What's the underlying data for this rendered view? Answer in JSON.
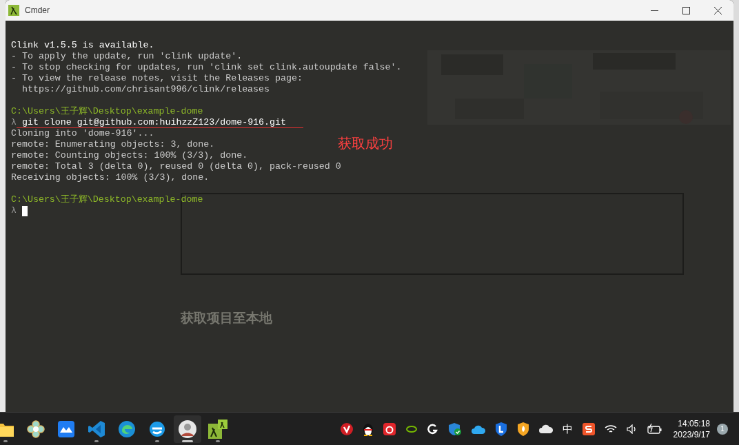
{
  "window": {
    "title": "Cmder"
  },
  "terminal": {
    "lines": [
      {
        "kind": "blank"
      },
      {
        "kind": "notice",
        "text": "Clink v1.5.5 is available."
      },
      {
        "kind": "plain",
        "text": "- To apply the update, run 'clink update'."
      },
      {
        "kind": "plain",
        "text": "- To stop checking for updates, run 'clink set clink.autoupdate false'."
      },
      {
        "kind": "plain",
        "text": "- To view the release notes, visit the Releases page:"
      },
      {
        "kind": "plain",
        "text": "  https://github.com/chrisant996/clink/releases"
      },
      {
        "kind": "blank"
      },
      {
        "kind": "path",
        "text": "C:\\Users\\王子辉\\Desktop\\example-dome"
      },
      {
        "kind": "command",
        "prompt": "λ",
        "text": "git clone git@github.com:huihzzZ123/dome-916.git",
        "underlined": true
      },
      {
        "kind": "plain",
        "text": "Cloning into 'dome-916'..."
      },
      {
        "kind": "plain",
        "text": "remote: Enumerating objects: 3, done."
      },
      {
        "kind": "plain",
        "text": "remote: Counting objects: 100% (3/3), done."
      },
      {
        "kind": "plain",
        "text": "remote: Total 3 (delta 0), reused 0 (delta 0), pack-reused 0"
      },
      {
        "kind": "plain",
        "text": "Receiving objects: 100% (3/3), done."
      },
      {
        "kind": "blank"
      },
      {
        "kind": "path",
        "text": "C:\\Users\\王子辉\\Desktop\\example-dome"
      },
      {
        "kind": "command",
        "prompt": "λ",
        "cursor": true
      }
    ]
  },
  "annotation": {
    "text": "获取成功"
  },
  "background_page": {
    "heading": "获取项目至本地"
  },
  "taskbar": {
    "apps": [
      {
        "kind": "folder",
        "running": true,
        "selected": false
      },
      {
        "kind": "flower",
        "running": false,
        "selected": false
      },
      {
        "kind": "mountain",
        "running": false,
        "selected": false
      },
      {
        "kind": "vscode",
        "running": true,
        "selected": false
      },
      {
        "kind": "edge",
        "running": false,
        "selected": false
      },
      {
        "kind": "edge2",
        "running": true,
        "selected": false
      },
      {
        "kind": "avatar",
        "running": true,
        "selected": true
      },
      {
        "kind": "cmder",
        "running": true,
        "selected": false
      }
    ],
    "tray": [
      {
        "kind": "red-v"
      },
      {
        "kind": "penguin"
      },
      {
        "kind": "music"
      },
      {
        "kind": "nvidia"
      },
      {
        "kind": "g"
      },
      {
        "kind": "shield-check"
      },
      {
        "kind": "cloud-blue"
      },
      {
        "kind": "shield-l"
      },
      {
        "kind": "shield-fire"
      },
      {
        "kind": "cloud-white"
      },
      {
        "kind": "ime",
        "text": "中"
      },
      {
        "kind": "sogou"
      },
      {
        "kind": "wifi"
      },
      {
        "kind": "speaker"
      },
      {
        "kind": "battery"
      }
    ],
    "clock": {
      "time": "14:05:18",
      "date": "2023/9/17"
    },
    "notifications": "1"
  }
}
